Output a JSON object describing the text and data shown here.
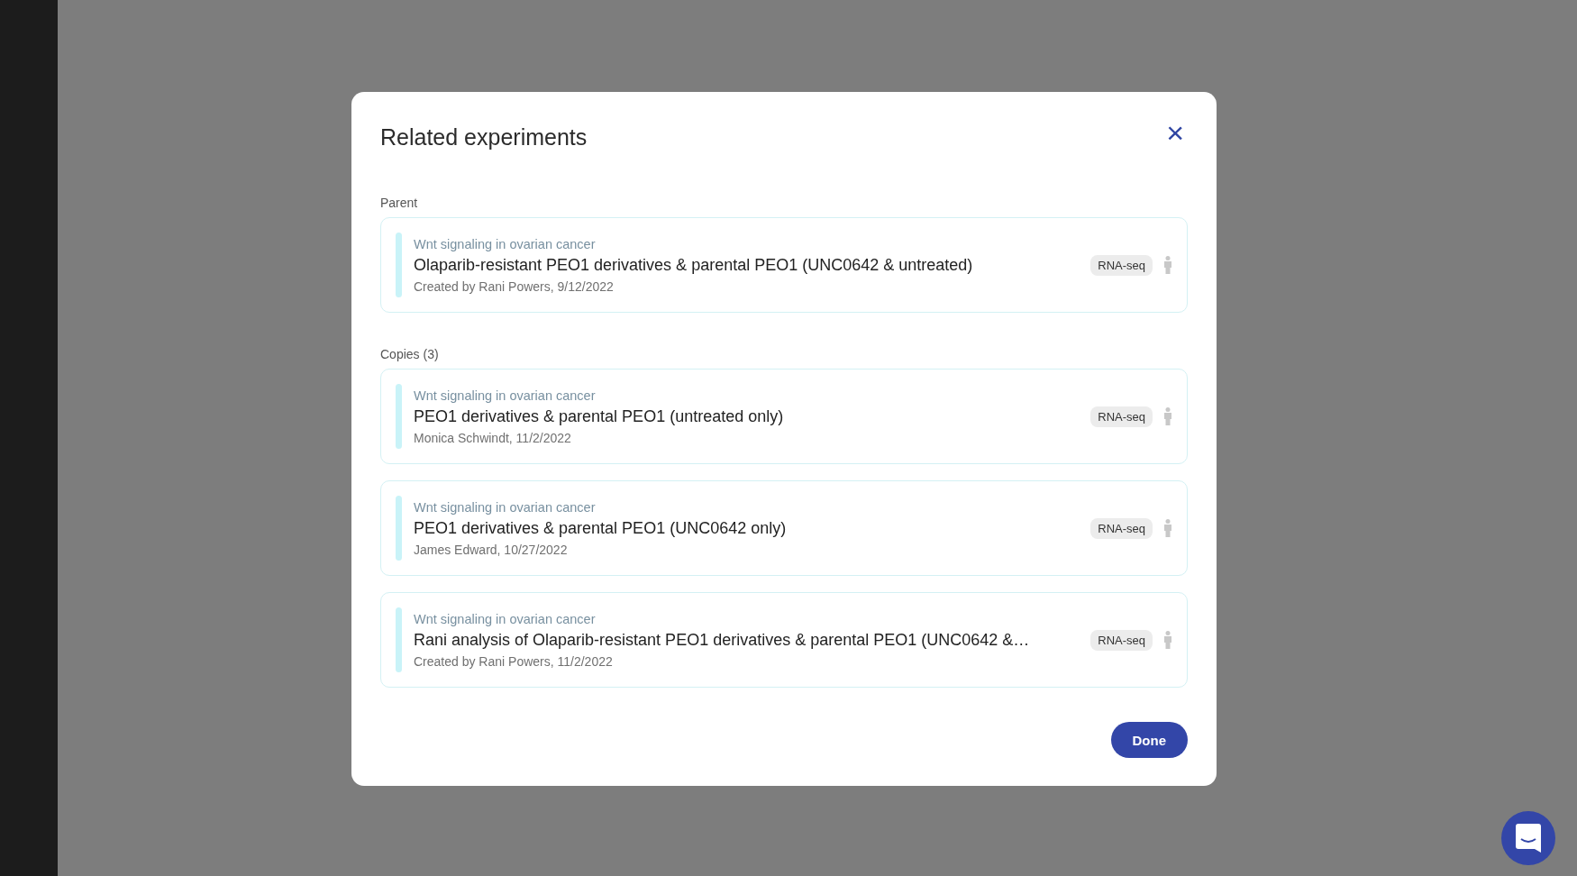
{
  "modal": {
    "title": "Related experiments",
    "close_icon": "×",
    "sections": [
      {
        "label": "Parent",
        "items": [
          {
            "project": "Wnt signaling in ovarian cancer",
            "title": "Olaparib-resistant PEO1 derivatives & parental PEO1 (UNC0642 & untreated)",
            "meta": "Created by Rani Powers, 9/12/2022",
            "tag": "RNA-seq"
          }
        ]
      },
      {
        "label": "Copies (3)",
        "items": [
          {
            "project": "Wnt signaling in ovarian cancer",
            "title": "PEO1 derivatives & parental PEO1 (untreated only)",
            "meta": "Monica Schwindt, 11/2/2022",
            "tag": "RNA-seq"
          },
          {
            "project": "Wnt signaling in ovarian cancer",
            "title": "PEO1 derivatives & parental PEO1 (UNC0642 only)",
            "meta": "James Edward, 10/27/2022",
            "tag": "RNA-seq"
          },
          {
            "project": "Wnt signaling in ovarian cancer",
            "title": "Rani analysis of Olaparib-resistant PEO1 derivatives & parental PEO1 (UNC0642 &…",
            "meta": "Created by Rani Powers, 11/2/2022",
            "tag": "RNA-seq"
          }
        ]
      }
    ],
    "done_button": "Done"
  }
}
